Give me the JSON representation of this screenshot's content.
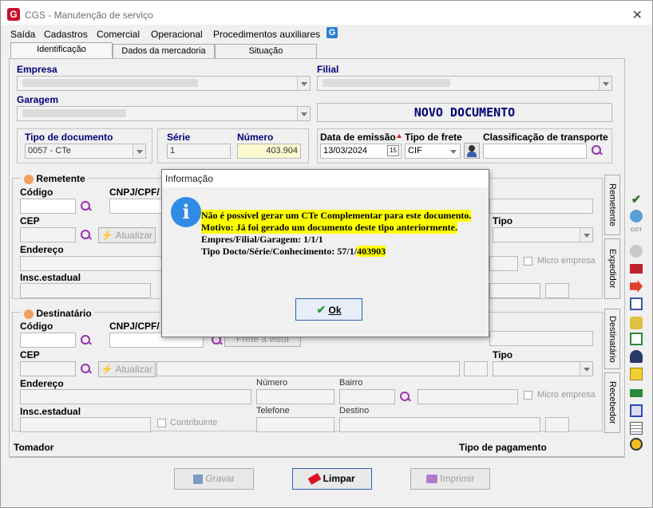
{
  "window": {
    "title": "CGS - Manutenção de serviço",
    "logo_letter": "G",
    "close_glyph": "✕"
  },
  "menu": {
    "items": [
      "Saída",
      "Cadastros",
      "Comercial",
      "Operacional",
      "Procedimentos auxiliares"
    ],
    "help_letter": "G"
  },
  "tabs": [
    "Identificação",
    "Dados da mercadoria",
    "Situação"
  ],
  "identificacao": {
    "empresa_label": "Empresa",
    "filial_label": "Filial",
    "garagem_label": "Garagem",
    "status_banner": "NOVO DOCUMENTO",
    "tipo_documento_label": "Tipo de documento",
    "tipo_documento_value": "0057 - CTe",
    "serie_label": "Série",
    "serie_value": "1",
    "numero_label": "Número",
    "numero_value": "403.904",
    "data_emissao_label": "Data de emissão",
    "data_emissao_value": "13/03/2024",
    "calendar_glyph": "15",
    "tipo_frete_label": "Tipo de frete",
    "tipo_frete_value": "CIF",
    "classificacao_label": "Classificação de transporte"
  },
  "remetente": {
    "group_label": "Remetente",
    "codigo_label": "Código",
    "cnpj_label": "CNPJ/CPF/",
    "cep_label": "CEP",
    "atualizar_label": "Atualizar",
    "tipo_label": "Tipo",
    "endereco_label": "Endereço",
    "micro_empresa_label": "Micro empresa",
    "insc_estadual_label": "Insc.estadual"
  },
  "destinatario": {
    "group_label": "Destinatário",
    "codigo_label": "Código",
    "cnpj_label": "CNPJ/CPF/",
    "frete_a_vista_label": "Frete à vista",
    "cep_label": "CEP",
    "atualizar_label": "Atualizar",
    "tipo_label": "Tipo",
    "endereco_label": "Endereço",
    "numero_label": "Número",
    "bairro_label": "Bairro",
    "micro_empresa_label": "Micro empresa",
    "insc_estadual_label": "Insc.estadual",
    "contribuinte_label": "Contribuinte",
    "telefone_label": "Telefone",
    "destino_label": "Destino"
  },
  "side_tabs": [
    "Remetente",
    "Expedidor",
    "Destinatário",
    "Recebedor"
  ],
  "footer": {
    "tomador_label": "Tomador",
    "tipo_pagamento_label": "Tipo de pagamento"
  },
  "buttons": {
    "gravar": "Gravar",
    "limpar": "Limpar",
    "imprimir": "Imprimir"
  },
  "dialog": {
    "title": "Informação",
    "icon_glyph": "i",
    "line1": "Não é possível gerar um CTe Complementar para este documento.",
    "line2": "Motivo: Já foi gerado um documento deste tipo anteriormente.",
    "line3": "Empres/Filial/Garagem: 1/1/1",
    "line4_prefix": "Tipo Docto/Série/Conhecimento: 57/1/",
    "line4_number": "403903",
    "ok_label": "Ok"
  },
  "toolbar_icons": [
    "check-icon",
    "refresh-icon",
    "ciot-icon",
    "gray-circle-icon",
    "red-truck-icon",
    "arrow-doc-icon",
    "documents-icon",
    "pointer-icon",
    "edit-doc-icon",
    "user-icon",
    "yellow-doc-icon",
    "green-truck-icon",
    "book-icon",
    "list-icon",
    "gear-icon"
  ]
}
